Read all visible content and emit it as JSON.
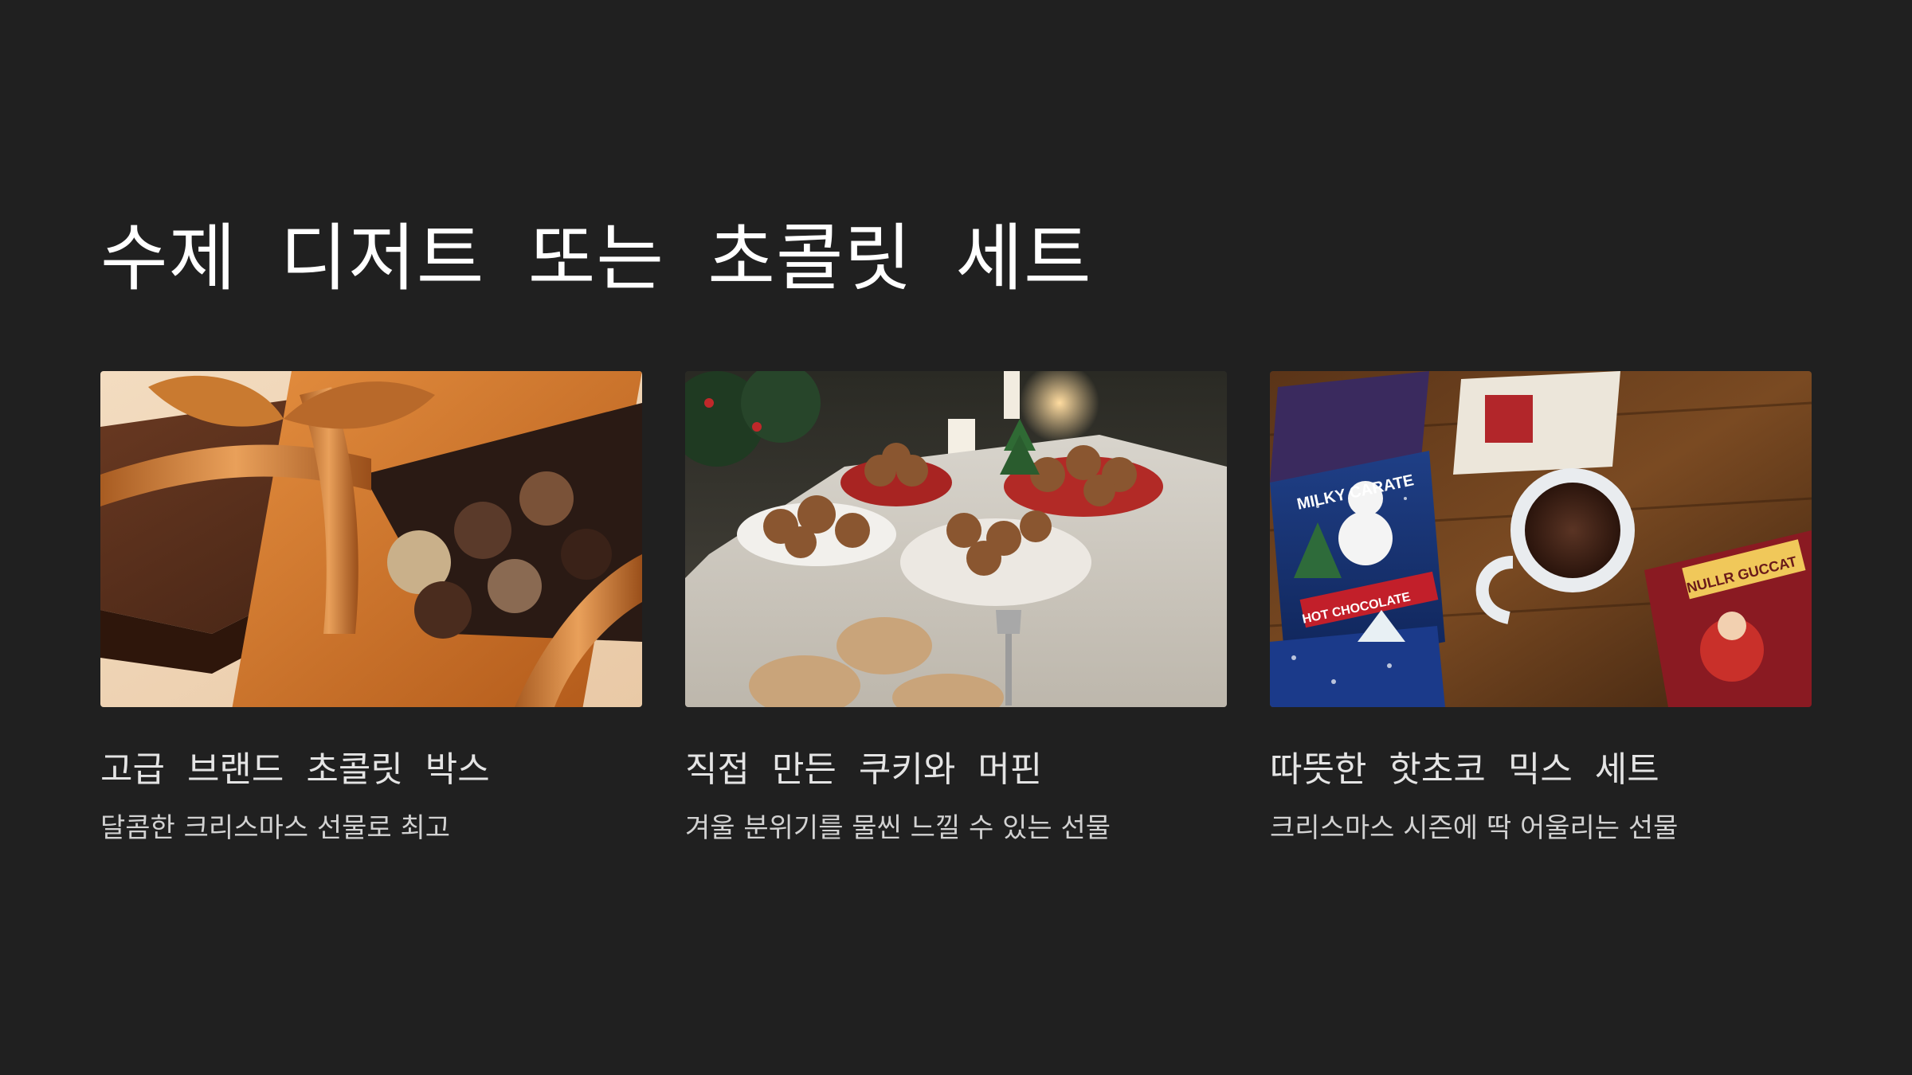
{
  "slide": {
    "title": "수제 디저트 또는 초콜릿 세트",
    "background_color": "#202020"
  },
  "cards": [
    {
      "heading": "고급 브랜드 초콜릿 박스",
      "description": "달콤한 크리스마스 선물로 최고",
      "image": "luxury-chocolate-box-photo"
    },
    {
      "heading": "직접 만든 쿠키와 머핀",
      "description": "겨울 분위기를 물씬 느낄 수 있는 선물",
      "image": "christmas-table-cookies-muffins-photo"
    },
    {
      "heading": "따뜻한 핫초코 믹스 세트",
      "description": "크리스마스 시즌에 딱 어울리는 선물",
      "image": "hot-chocolate-mix-packets-photo",
      "image_text": [
        "MILKY CARATE",
        "HOT CHOCOLATE",
        "NULLR GUCCAT"
      ]
    }
  ]
}
